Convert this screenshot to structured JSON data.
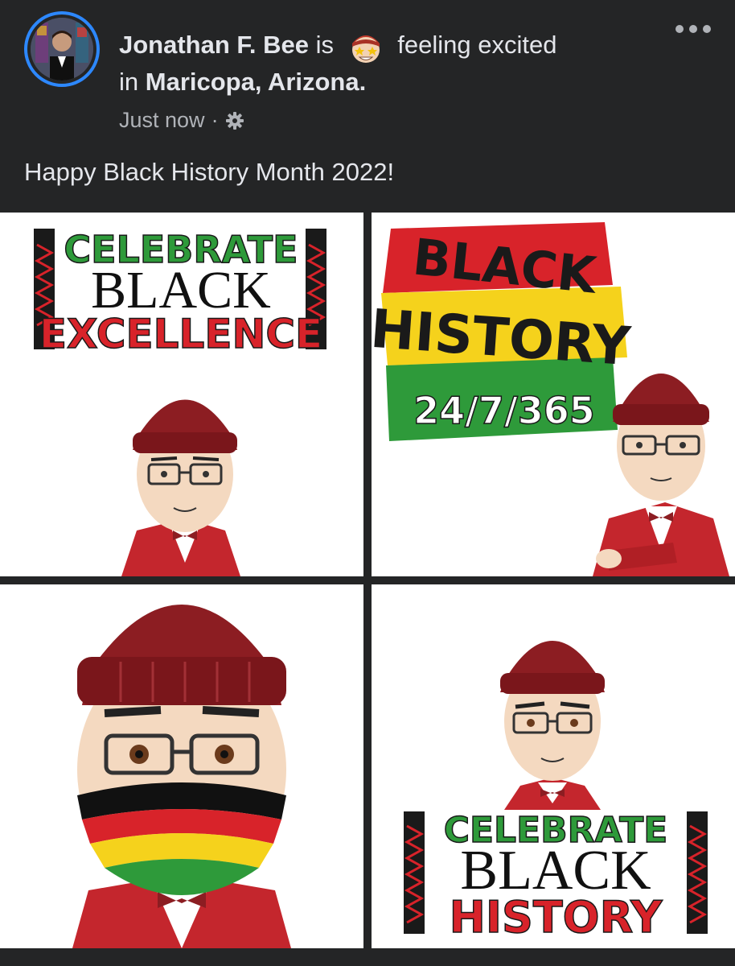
{
  "post": {
    "author": "Jonathan F. Bee",
    "is_word": "is",
    "feeling": "feeling excited",
    "location_prefix": "in",
    "location": "Maricopa, Arizona.",
    "timestamp": "Just now",
    "separator": "·",
    "text": "Happy Black History Month 2022!",
    "privacy_icon": "gear-icon",
    "feeling_icon": "star-eyes-emoji-icon"
  },
  "images": [
    {
      "line1": "CELEBRATE",
      "line2": "BLACK",
      "line3": "EXCELLENCE"
    },
    {
      "line1": "BLACK",
      "line2": "HISTORY",
      "line3": "24/7/365"
    },
    {
      "mask": "striped-face-mask"
    },
    {
      "line1": "CELEBRATE",
      "line2": "BLACK",
      "line3": "HISTORY"
    }
  ],
  "colors": {
    "background": "#242526",
    "primary_text": "#e4e6eb",
    "secondary_text": "#b0b3b8",
    "avatar_ring": "#2d88ff",
    "green": "#2e9a3a",
    "red": "#d8232a",
    "yellow": "#f5d21c",
    "hat": "#8c1d22",
    "jacket": "#c4262d"
  }
}
